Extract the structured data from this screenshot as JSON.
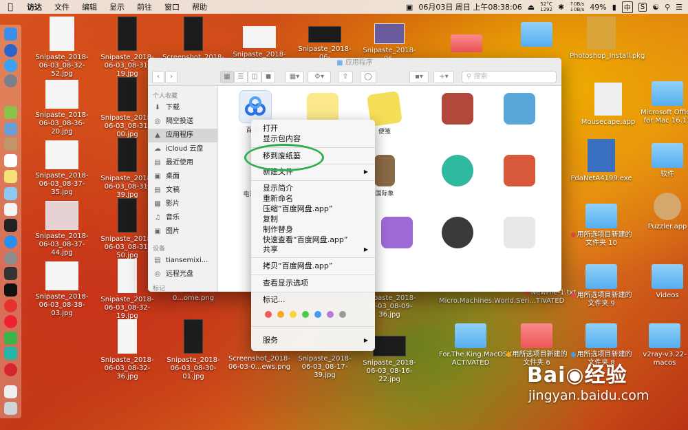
{
  "menubar": {
    "app": "访达",
    "items": [
      "文件",
      "编辑",
      "显示",
      "前往",
      "窗口",
      "帮助"
    ],
    "datetime": "06月03日 周日 上午08:38:06",
    "temp_cpu": "52°C",
    "rpm": "1292",
    "net_up": "0B/s",
    "net_down": "0B/s",
    "battery": "49%",
    "input": "中",
    "sogou": "S"
  },
  "desktop": {
    "icons": {
      "i1": "Snipaste_2018-06-03_08-32-52.jpg",
      "i2": "Snipaste_2018-06-03_08-31-19.jpg",
      "i3": "Screenshot_2018-",
      "i4": "Snipaste_2018-06-",
      "i5": "Snipaste_2018-06-",
      "i6": "Snipaste_2018-06-",
      "c1r2": "Snipaste_2018-06-03_08-36-20.jpg",
      "c2r2": "Snipaste_2018-06-03_08-31-00.jpg",
      "c1r3": "Snipaste_2018-06-03_08-37-35.jpg",
      "c2r3": "Snipaste_2018-06-03_08-31-39.jpg",
      "c1r4": "Snipaste_2018-06-03_08-37-44.jpg",
      "c2r4": "Snipaste_2018-06-03_08-31-50.jpg",
      "c1r5": "Snipaste_2018-06-03_08-38-03.jpg",
      "c2r5": "Snipaste_2018-06-03_08-32-19.jpg",
      "c3r5": "Screenshot_2018-06-03-0...ome.png",
      "c6r5": "Snipaste_2018-06-03_08-09-36.jpg",
      "c2r6": "Snipaste_2018-06-03_08-32-36.jpg",
      "c3r6": "Snipaste_2018-06-03_08-30-01.jpg",
      "c4r6": "Screenshot_2018-06-03-0...ews.png",
      "c5r6": "Snipaste_2018-06-03_08-17-39.jpg",
      "c6r6": "Snipaste_2018-06-03_08-16-22.jpg",
      "r1": "Photoshop_Install.pkg",
      "r2": "Mousecape.app",
      "r3": "Microsoft Office for Mac 16.13",
      "r4": "PdaNetA4199.exe",
      "r5": "软件",
      "r6": "Puzzler.app",
      "r7": "用所选项目新建的文件夹 10",
      "r8": "NewFile-1.txt",
      "r9": "用所选项目新建的文件夹 9",
      "r10": "Videos",
      "r11": "Micro.Machines.World.Seri...TIVATED",
      "r12": "For.The.King.MacOSX-ACTiVATED",
      "r13": "用所选项目新建的文件夹 6",
      "r14": "用所选项目新建的文件夹 8",
      "r15": "v2ray-v3.22-macos"
    }
  },
  "finder": {
    "title": "应用程序",
    "search_placeholder": "搜索",
    "sidebar_header_favorites": "个人收藏",
    "favorites": [
      "下载",
      "隔空投送",
      "应用程序",
      "iCloud 云盘",
      "最近使用",
      "桌面",
      "文稿",
      "影片",
      "音乐",
      "图片"
    ],
    "sidebar_header_devices": "设备",
    "devices": [
      "tiansemixi...",
      "远程光盘"
    ],
    "sidebar_header_tags": "标记",
    "apps": {
      "baidu": "百度网",
      "notes": "便笺",
      "battery": "电池监",
      "chess": "国际象"
    }
  },
  "context_menu": {
    "open": "打开",
    "show_package": "显示包内容",
    "move_to_trash": "移到废纸篓",
    "new_file": "新建文件",
    "get_info": "显示简介",
    "rename": "重新命名",
    "compress": "压缩“百度网盘.app”",
    "duplicate": "复制",
    "make_alias": "制作替身",
    "quick_look": "快速查看“百度网盘.app”",
    "share": "共享",
    "copy": "拷贝“百度网盘.app”",
    "view_options": "查看显示选项",
    "tags": "标记...",
    "services": "服务",
    "tag_colors": [
      "#f05a55",
      "#f5a623",
      "#f8d335",
      "#4cc94b",
      "#3f9cf3",
      "#b779d6",
      "#9a9a9a"
    ]
  },
  "watermark": {
    "brand": "Bai",
    "brand2": "经验",
    "url": "jingyan.baidu.com"
  }
}
